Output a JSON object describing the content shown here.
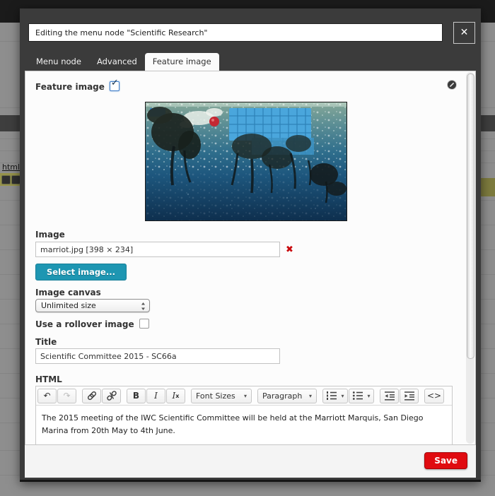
{
  "backdrop": {
    "partial_link": "html"
  },
  "modal": {
    "title_value": "Editing the menu node \"Scientific Research\"",
    "tabs": {
      "menu_node": "Menu node",
      "advanced": "Advanced",
      "feature_image": "Feature image"
    },
    "save_label": "Save"
  },
  "form": {
    "feature_label": "Feature image",
    "image_label": "Image",
    "image_filename": "marriot.jpg [398 × 234]",
    "select_image_label": "Select image...",
    "canvas_label": "Image canvas",
    "canvas_selected": "Unlimited size",
    "rollover_label": "Use a rollover image",
    "title_label": "Title",
    "title_value": "Scientific Committee 2015 - SC66a",
    "html_label": "HTML"
  },
  "editor": {
    "undo_glyph": "↶",
    "redo_glyph": "↷",
    "bold_glyph": "B",
    "italic_glyph": "I",
    "clear_glyph": "I",
    "clear_sub": "x",
    "font_sizes_label": "Font Sizes",
    "paragraph_label": "Paragraph",
    "code_glyph": "<>",
    "body_text": "The 2015 meeting of the IWC Scientific Committee will be held at the Marriott Marquis, San Diego Marina from 20th May to 4th June."
  },
  "glyphs": {
    "close": "✕",
    "check": "✓",
    "remove": "✖",
    "caret": "▾"
  },
  "colors": {
    "accent_teal": "#1e96b2",
    "save_red": "#e00b10",
    "modal_dark": "#3b3b3b",
    "highlight_olive": "#96934a",
    "topbar_black": "#1b1b1b"
  }
}
